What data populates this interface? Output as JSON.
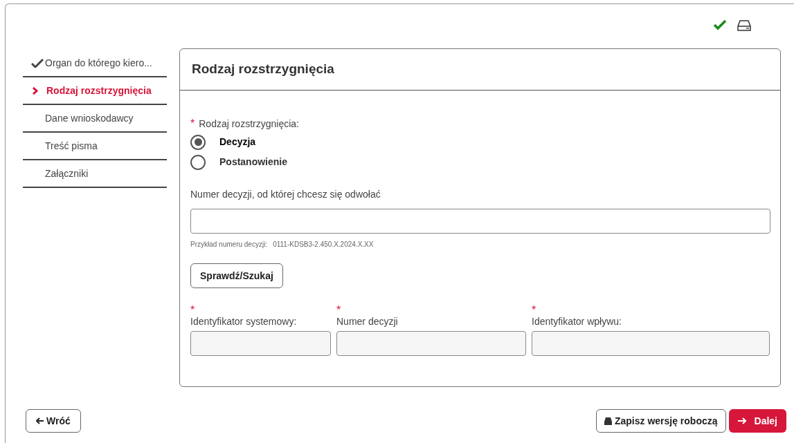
{
  "toolbar": {
    "status_ok": true
  },
  "steps": [
    {
      "label": "Organ do którego kiero...",
      "completed": true,
      "selected": false
    },
    {
      "label": "Rodzaj rozstrzygnięcia",
      "completed": false,
      "selected": true
    },
    {
      "label": "Dane wnioskodawcy",
      "completed": false,
      "selected": false
    },
    {
      "label": "Treść pisma",
      "completed": false,
      "selected": false
    },
    {
      "label": "Załączniki",
      "completed": false,
      "selected": false
    }
  ],
  "panel": {
    "title": "Rodzaj rozstrzygnięcia",
    "radio_group": {
      "label": "Rodzaj rozstrzygnięcia:",
      "required_mark": "*",
      "options": [
        {
          "label": "Decyzja",
          "selected": true
        },
        {
          "label": "Postanowienie",
          "selected": false
        }
      ]
    },
    "decision_field": {
      "label": "Numer decyzji, od której chcesz się odwołać",
      "hint": "Przykład numeru decyzji:",
      "example": "0111-KDSB3-2.450.X.2024.X.XX"
    },
    "search_button": "Sprawdź/Szukaj",
    "result_fields": [
      {
        "label": "Identyfikator systemowy:",
        "required_mark": "*"
      },
      {
        "label": "Numer decyzji",
        "required_mark": "*"
      },
      {
        "label": "Identyfikator wpływu:",
        "required_mark": "*"
      }
    ]
  },
  "footer": {
    "back": "Wróć",
    "save": "Zapisz wersję roboczą",
    "next": "Dalej"
  }
}
